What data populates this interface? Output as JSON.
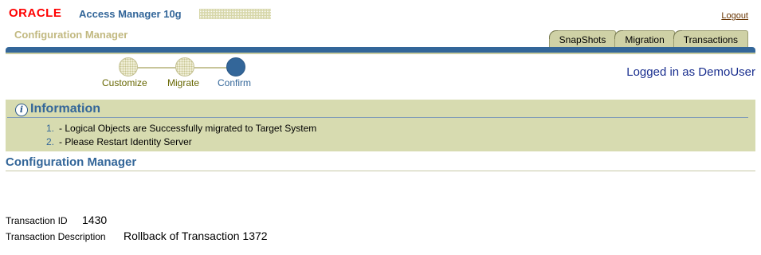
{
  "header": {
    "oracle_logo": "ORACLE",
    "product_name": "Access Manager 10g",
    "subtitle": "Configuration Manager",
    "logout": "Logout"
  },
  "tabs": [
    {
      "label": "SnapShots"
    },
    {
      "label": "Migration"
    },
    {
      "label": "Transactions"
    }
  ],
  "train": {
    "steps": [
      {
        "label": "Customize",
        "state": "visited"
      },
      {
        "label": "Migrate",
        "state": "visited"
      },
      {
        "label": "Confirm",
        "state": "current"
      }
    ]
  },
  "user": {
    "logged_in_text": "Logged in as DemoUser"
  },
  "info": {
    "title": "Information",
    "messages": [
      {
        "number": "1.",
        "text": "- Logical Objects are Successfully migrated to Target System"
      },
      {
        "number": "2.",
        "text": "- Please Restart Identity Server"
      }
    ]
  },
  "section": {
    "title": "Configuration Manager"
  },
  "transaction": {
    "id_label": "Transaction ID",
    "id_value": "1430",
    "desc_label": "Transaction Description",
    "desc_value": "Rollback of Transaction 1372"
  },
  "colors": {
    "brand_blue": "#336699",
    "oracle_red": "#ff0000",
    "panel_bg": "#d7dbb0"
  }
}
